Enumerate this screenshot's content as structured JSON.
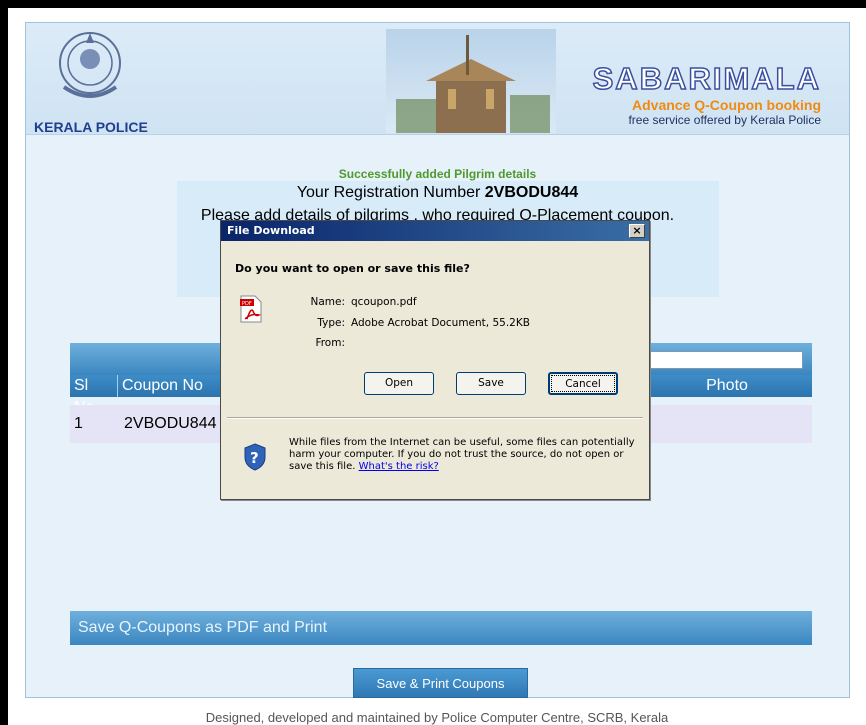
{
  "header": {
    "org_label": "KERALA POLICE",
    "title": "SABARIMALA",
    "subtitle": "Advance Q-Coupon booking",
    "tagline": "free service offered by Kerala Police"
  },
  "messages": {
    "success": "Successfully added Pilgrim details",
    "reg_prefix": "Your Registration Number ",
    "reg_number": "2VBODU844",
    "add_pilgrims": "Please add details of pilgrims , who required Q-Placement coupon."
  },
  "table": {
    "columns": [
      "Sl No.",
      "Coupon No",
      "Photo"
    ],
    "rows": [
      {
        "sl": "1",
        "coupon": "2VBODU844"
      }
    ]
  },
  "save_bar": {
    "label": "Save Q-Coupons as PDF and Print"
  },
  "print_button": {
    "label": "Save & Print Coupons"
  },
  "footer": {
    "text": "Designed, developed and maintained by Police Computer Centre, SCRB, Kerala"
  },
  "dialog": {
    "title": "File Download",
    "close_label": "×",
    "question": "Do you want to open or save this file?",
    "name_label": "Name:",
    "name_value": "qcoupon.pdf",
    "type_label": "Type:",
    "type_value": "Adobe Acrobat Document, 55.2KB",
    "from_label": "From:",
    "from_value": "",
    "open_label": "Open",
    "save_label": "Save",
    "cancel_label": "Cancel",
    "warning": "While files from the Internet can be useful, some files can potentially harm your computer. If you do not trust the source, do not open or save this file.",
    "risk_link": "What's the risk?"
  },
  "colors": {
    "header_bg": "#dcebf7",
    "accent_orange": "#f08a10",
    "table_blue": "#3b86c0",
    "dialog_title": "#0a246a"
  }
}
